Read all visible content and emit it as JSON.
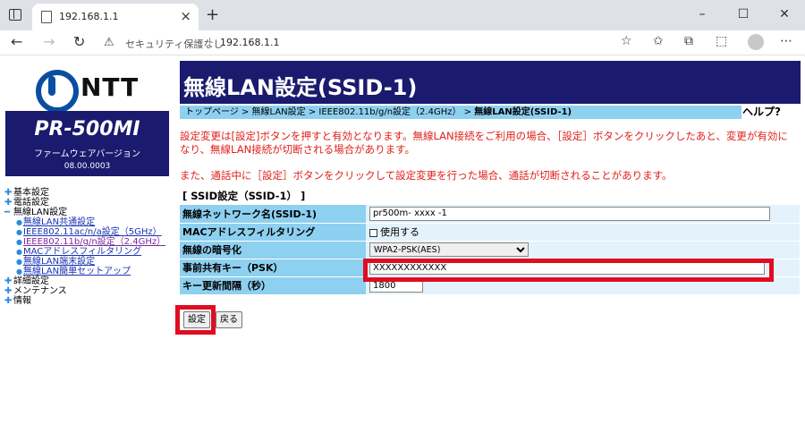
{
  "browser": {
    "tab_title": "192.168.1.1",
    "security_text": "セキュリティ保護なし",
    "url": "192.168.1.1"
  },
  "logo": {
    "text": "NTT"
  },
  "device": {
    "model": "PR-500MI",
    "firmware_label": "ファームウェアバージョン",
    "firmware_version": "08.00.0003"
  },
  "sidebar": {
    "items": [
      {
        "label": "基本設定",
        "state": "collapsed"
      },
      {
        "label": "電話設定",
        "state": "collapsed"
      },
      {
        "label": "無線LAN設定",
        "state": "expanded",
        "children": [
          {
            "label": "無線LAN共通設定"
          },
          {
            "label": "IEEE802.11ac/n/a設定（5GHz）"
          },
          {
            "label": "IEEE802.11b/g/n設定（2.4GHz）"
          },
          {
            "label": "MACアドレスフィルタリング"
          },
          {
            "label": "無線LAN端末設定"
          },
          {
            "label": "無線LAN簡単セットアップ"
          }
        ]
      },
      {
        "label": "詳細設定",
        "state": "collapsed"
      },
      {
        "label": "メンテナンス",
        "state": "collapsed"
      },
      {
        "label": "情報",
        "state": "collapsed"
      }
    ]
  },
  "header": {
    "title": "無線LAN設定(SSID-1)"
  },
  "breadcrumb": {
    "path": "トップページ > 無線LAN設定 > IEEE802.11b/g/n設定（2.4GHz） > ",
    "current": "無線LAN設定(SSID-1)",
    "help": "ヘルプ?"
  },
  "notice": {
    "line1": "設定変更は[設定]ボタンを押すと有効となります。無線LAN接続をご利用の場合、［設定］ボタンをクリックしたあと、変更が有効になり、無線LAN接続が切断される場合があります。",
    "line2": "また、通話中に［設定］ボタンをクリックして設定変更を行った場合、通話が切断されることがあります。"
  },
  "form": {
    "section_title": "[ SSID設定（SSID-1） ]",
    "ssid_label": "無線ネットワーク名(SSID-1)",
    "ssid_value": "pr500m- xxxx -1",
    "mac_label": "MACアドレスフィルタリング",
    "mac_option": "使用する",
    "encryption_label": "無線の暗号化",
    "encryption_value": "WPA2-PSK(AES)",
    "psk_label": "事前共有キー（PSK）",
    "psk_value": "XXXXXXXXXXXX",
    "rekey_label": "キー更新間隔（秒）",
    "rekey_value": "1800"
  },
  "buttons": {
    "apply": "設定",
    "back": "戻る"
  },
  "colors": {
    "navy": "#1a1a6e",
    "label_bg": "#8ed0f0",
    "notice_red": "#e0201a",
    "highlight": "#e00c22"
  }
}
